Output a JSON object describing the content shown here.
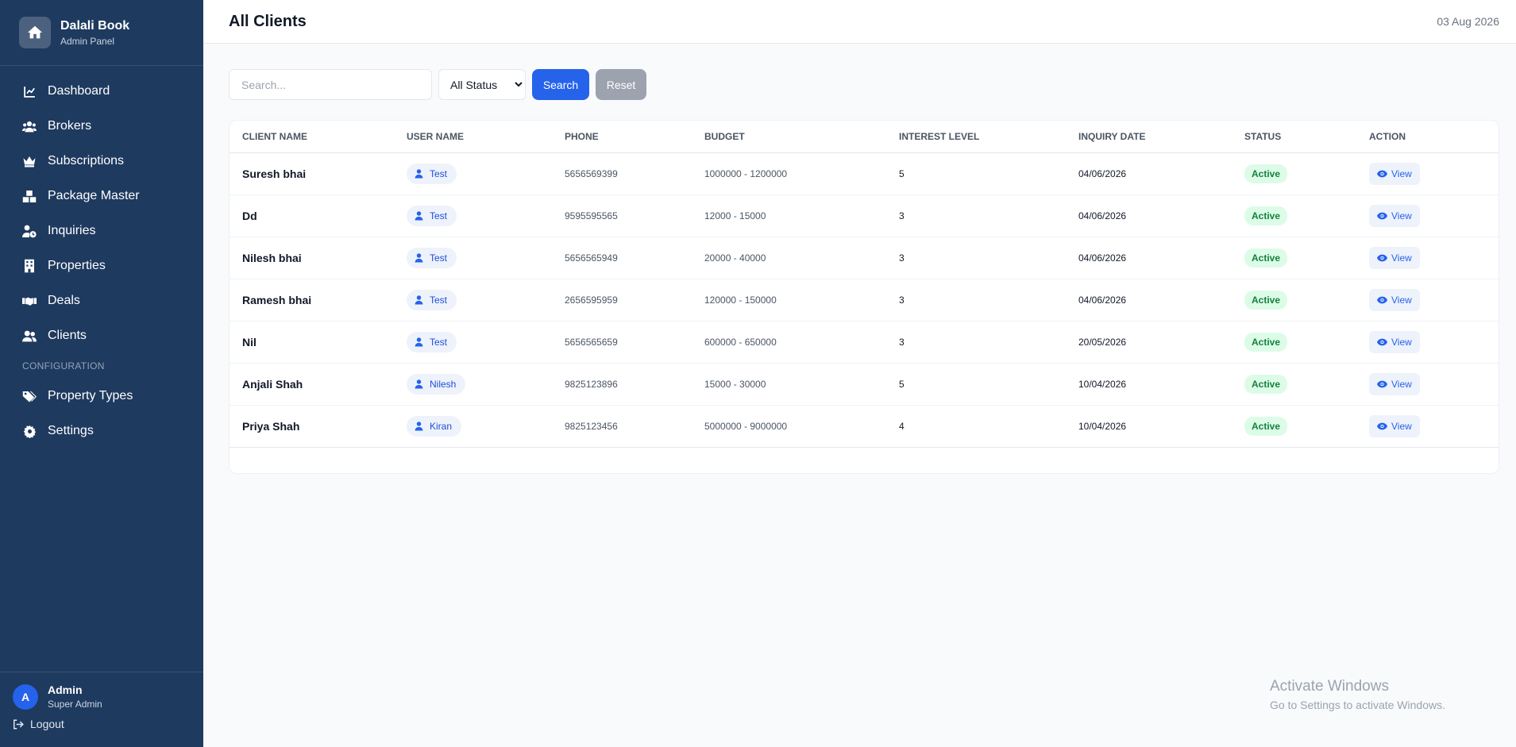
{
  "brand": {
    "title": "Dalali Book",
    "subtitle": "Admin Panel"
  },
  "nav": {
    "items": [
      {
        "label": "Dashboard",
        "icon": "chart-line-icon"
      },
      {
        "label": "Brokers",
        "icon": "users-icon"
      },
      {
        "label": "Subscriptions",
        "icon": "crown-icon"
      },
      {
        "label": "Package Master",
        "icon": "boxes-icon"
      },
      {
        "label": "Inquiries",
        "icon": "user-clock-icon"
      },
      {
        "label": "Properties",
        "icon": "building-icon"
      },
      {
        "label": "Deals",
        "icon": "handshake-icon"
      },
      {
        "label": "Clients",
        "icon": "user-group-icon"
      }
    ],
    "section_label": "CONFIGURATION",
    "config_items": [
      {
        "label": "Property Types",
        "icon": "tags-icon"
      },
      {
        "label": "Settings",
        "icon": "gear-icon"
      }
    ]
  },
  "user": {
    "initial": "A",
    "name": "Admin",
    "role": "Super Admin",
    "logout_label": "Logout"
  },
  "header": {
    "title": "All Clients",
    "date": "03 Aug 2026"
  },
  "filters": {
    "search_placeholder": "Search...",
    "status_value": "All Status",
    "search_label": "Search",
    "reset_label": "Reset"
  },
  "table": {
    "columns": [
      "Client Name",
      "User Name",
      "Phone",
      "Budget",
      "Interest Level",
      "Inquiry Date",
      "Status",
      "Action"
    ],
    "rows": [
      {
        "client": "Suresh bhai",
        "user": "Test",
        "phone": "5656569399",
        "budget": "1000000 - 1200000",
        "interest": "5",
        "date": "04/06/2026",
        "status": "Active",
        "action": "View"
      },
      {
        "client": "Dd",
        "user": "Test",
        "phone": "9595595565",
        "budget": "12000 - 15000",
        "interest": "3",
        "date": "04/06/2026",
        "status": "Active",
        "action": "View"
      },
      {
        "client": "Nilesh bhai",
        "user": "Test",
        "phone": "5656565949",
        "budget": "20000 - 40000",
        "interest": "3",
        "date": "04/06/2026",
        "status": "Active",
        "action": "View"
      },
      {
        "client": "Ramesh bhai",
        "user": "Test",
        "phone": "2656595959",
        "budget": "120000 - 150000",
        "interest": "3",
        "date": "04/06/2026",
        "status": "Active",
        "action": "View"
      },
      {
        "client": "Nil",
        "user": "Test",
        "phone": "5656565659",
        "budget": "600000 - 650000",
        "interest": "3",
        "date": "20/05/2026",
        "status": "Active",
        "action": "View"
      },
      {
        "client": "Anjali Shah",
        "user": "Nilesh",
        "phone": "9825123896",
        "budget": "15000 - 30000",
        "interest": "5",
        "date": "10/04/2026",
        "status": "Active",
        "action": "View"
      },
      {
        "client": "Priya Shah",
        "user": "Kiran",
        "phone": "9825123456",
        "budget": "5000000 - 9000000",
        "interest": "4",
        "date": "10/04/2026",
        "status": "Active",
        "action": "View"
      }
    ]
  },
  "watermark": {
    "title": "Activate Windows",
    "subtitle": "Go to Settings to activate Windows."
  },
  "colors": {
    "sidebar": "#1e3a5f",
    "accent": "#2563eb",
    "status_active_bg": "#dcfce7",
    "status_active_text": "#15803d"
  }
}
